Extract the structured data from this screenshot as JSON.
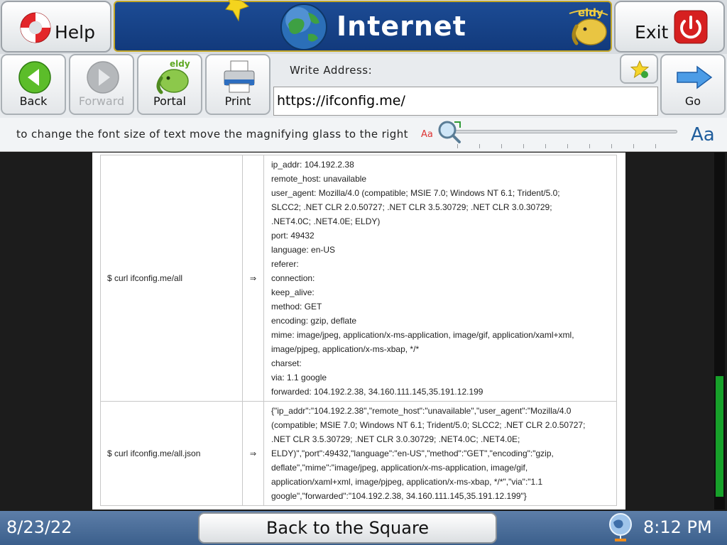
{
  "header": {
    "help_label": "Help",
    "title": "Internet",
    "exit_label": "Exit",
    "logo_text": "eldy"
  },
  "toolbar": {
    "back_label": "Back",
    "forward_label": "Forward",
    "portal_label": "Portal",
    "print_label": "Print",
    "address_label": "Write Address:",
    "address_value": "https://ifconfig.me/",
    "go_label": "Go"
  },
  "fontbar": {
    "hint": "to change the font size of text move the magnifying glass to the right",
    "small_label": "Aa",
    "large_label": "Aa"
  },
  "content": {
    "rows": [
      {
        "command": "$ curl ifconfig.me/all",
        "arrow": "⇒",
        "lines": [
          "ip_addr: 104.192.2.38",
          "remote_host: unavailable",
          "user_agent: Mozilla/4.0 (compatible; MSIE 7.0; Windows NT 6.1; Trident/5.0;",
          "SLCC2; .NET CLR 2.0.50727; .NET CLR 3.5.30729; .NET CLR 3.0.30729;",
          ".NET4.0C; .NET4.0E; ELDY)",
          "port: 49432",
          "language: en-US",
          "referer:",
          "connection:",
          "keep_alive:",
          "method: GET",
          "encoding: gzip, deflate",
          "mime: image/jpeg, application/x-ms-application, image/gif, application/xaml+xml,",
          "image/pjpeg, application/x-ms-xbap, */*",
          "charset:",
          "via: 1.1 google",
          "forwarded: 104.192.2.38, 34.160.111.145,35.191.12.199"
        ]
      },
      {
        "command": "$ curl ifconfig.me/all.json",
        "arrow": "⇒",
        "lines": [
          "{\"ip_addr\":\"104.192.2.38\",\"remote_host\":\"unavailable\",\"user_agent\":\"Mozilla/4.0",
          "(compatible; MSIE 7.0; Windows NT 6.1; Trident/5.0; SLCC2; .NET CLR 2.0.50727;",
          ".NET CLR 3.5.30729; .NET CLR 3.0.30729; .NET4.0C; .NET4.0E;",
          "ELDY)\",\"port\":49432,\"language\":\"en-US\",\"method\":\"GET\",\"encoding\":\"gzip,",
          "deflate\",\"mime\":\"image/jpeg, application/x-ms-application, image/gif,",
          "application/xaml+xml, image/pjpeg, application/x-ms-xbap, */*\",\"via\":\"1.1",
          "google\",\"forwarded\":\"104.192.2.38, 34.160.111.145,35.191.12.199\"}"
        ]
      }
    ]
  },
  "footer": {
    "date": "8/23/22",
    "square_label": "Back to the Square",
    "time": "8:12 PM"
  },
  "colors": {
    "title_bg": "#1c4b94",
    "title_border": "#c2a626",
    "footer_bg": "#4a6d98",
    "scroll_thumb": "#17a12a",
    "exit_red": "#d62020"
  }
}
